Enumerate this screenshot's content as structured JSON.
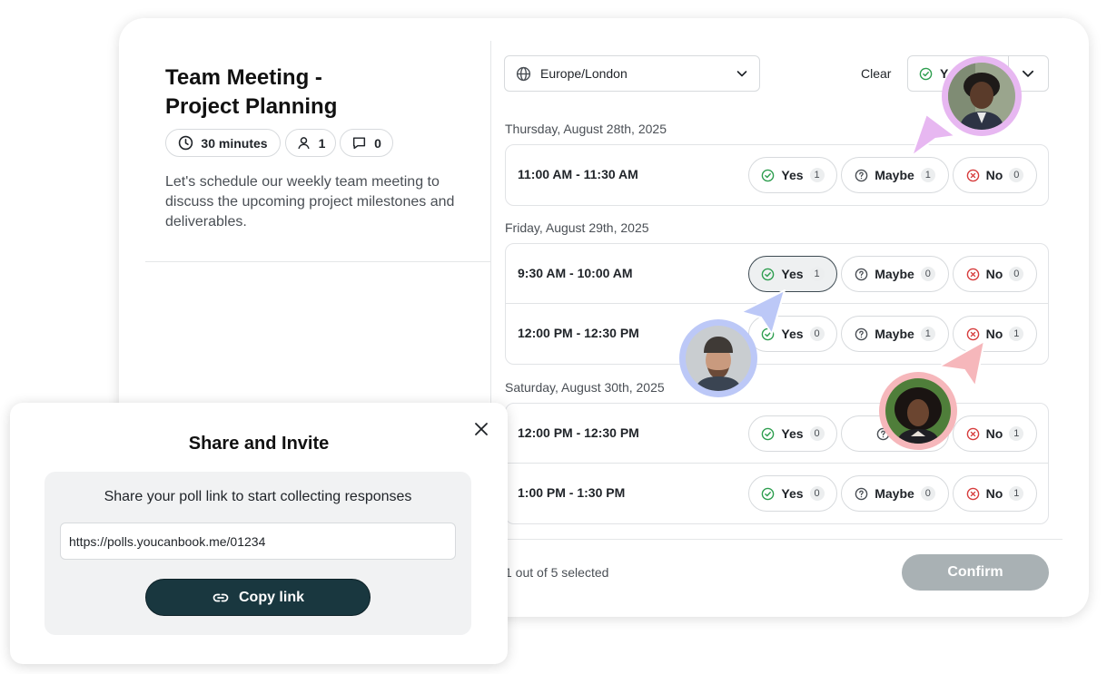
{
  "event": {
    "title_line1": "Team Meeting -",
    "title_line2": "Project Planning",
    "duration": "30 minutes",
    "participants": "1",
    "comments": "0",
    "description": "Let's schedule our weekly team meeting to discuss the upcoming project milestones and deliverables."
  },
  "toolbar": {
    "timezone": "Europe/London",
    "clear_label": "Clear",
    "filter_label": "Y"
  },
  "groups": [
    {
      "date": "Thursday, August 28th, 2025",
      "slots": [
        {
          "time": "11:00 AM - 11:30 AM",
          "yes": "1",
          "maybe": "1",
          "no": "0",
          "selected": ""
        }
      ]
    },
    {
      "date": "Friday, August 29th, 2025",
      "slots": [
        {
          "time": "9:30 AM - 10:00 AM",
          "yes": "1",
          "maybe": "0",
          "no": "0",
          "selected": "yes"
        },
        {
          "time": "12:00 PM - 12:30 PM",
          "yes": "0",
          "maybe": "1",
          "no": "1",
          "selected": ""
        }
      ]
    },
    {
      "date": "Saturday, August 30th, 2025",
      "slots": [
        {
          "time": "12:00 PM - 12:30 PM",
          "yes": "0",
          "maybe": "",
          "no": "1",
          "selected": ""
        },
        {
          "time": "1:00 PM - 1:30 PM",
          "yes": "0",
          "maybe": "0",
          "no": "1",
          "selected": ""
        }
      ]
    }
  ],
  "labels": {
    "yes": "Yes",
    "maybe": "Maybe",
    "no": "No",
    "maybe_partial": "Ma"
  },
  "footer": {
    "selected_text": "1 out of 5 selected",
    "confirm_label": "Confirm"
  },
  "share": {
    "title": "Share and Invite",
    "subtitle": "Share your poll link to start collecting responses",
    "link": "https://polls.youcanbook.me/01234",
    "copy_label": "Copy link"
  },
  "colors": {
    "yes": "#2e9e4f",
    "no": "#d63c3c",
    "primary_dark": "#19373f",
    "confirm_disabled": "#a9b1b4",
    "cursor_purple": "#e7b7f1",
    "cursor_blue": "#bcc8f7",
    "cursor_pink": "#f6b7bb"
  }
}
